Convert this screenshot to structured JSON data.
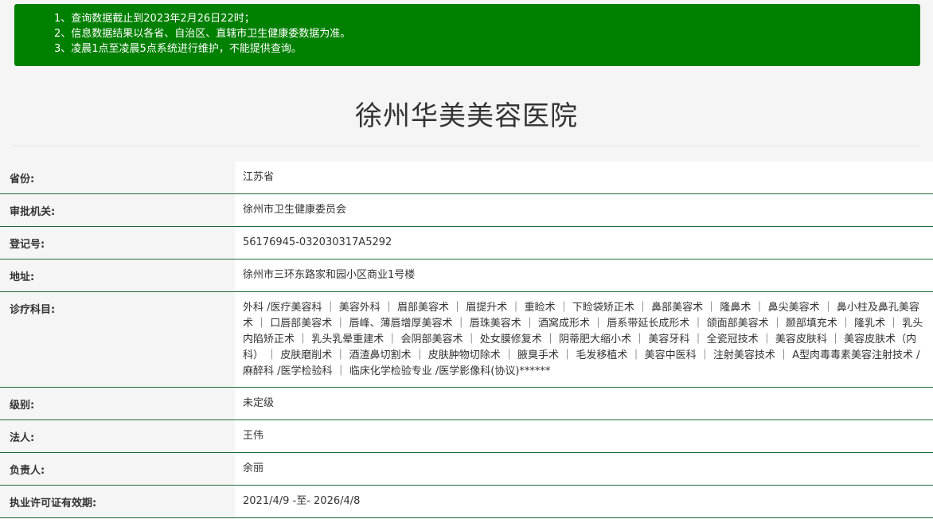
{
  "notice": {
    "lines": [
      "1、查询数据截止到2023年2月26日22时；",
      "2、信息数据结果以各省、自治区、直辖市卫生健康委数据为准。",
      "3、凌晨1点至凌晨5点系统进行维护，不能提供查询。"
    ]
  },
  "page": {
    "title": "徐州华美美容医院"
  },
  "info": {
    "province": {
      "label": "省份:",
      "value": "江苏省"
    },
    "authority": {
      "label": "审批机关:",
      "value": "徐州市卫生健康委员会"
    },
    "reg_no": {
      "label": "登记号:",
      "value": "56176945-032030317A5292"
    },
    "address": {
      "label": "地址:",
      "value": "徐州市三环东路家和园小区商业1号楼"
    },
    "departments": {
      "label": "诊疗科目:",
      "value": "外科 /医疗美容科 ｜ 美容外科 ｜ 眉部美容术 ｜ 眉提升术 ｜ 重睑术 ｜ 下睑袋矫正术 ｜ 鼻部美容术 ｜ 隆鼻术 ｜ 鼻尖美容术 ｜ 鼻小柱及鼻孔美容术 ｜ 口唇部美容术 ｜ 唇峰、薄唇增厚美容术 ｜ 唇珠美容术 ｜ 酒窝成形术 ｜ 唇系带延长成形术 ｜ 颌面部美容术 ｜ 颞部填充术 ｜ 隆乳术 ｜ 乳头内陷矫正术 ｜ 乳头乳晕重建术 ｜ 会阴部美容术 ｜ 处女膜修复术 ｜ 阴蒂肥大缩小术 ｜ 美容牙科 ｜ 全瓷冠技术 ｜ 美容皮肤科 ｜ 美容皮肤术（内科） ｜ 皮肤磨削术 ｜ 酒渣鼻切割术 ｜ 皮肤肿物切除术 ｜ 腋臭手术 ｜ 毛发移植术 ｜ 美容中医科 ｜ 注射美容技术 ｜ A型肉毒毒素美容注射技术 /麻醉科 /医学检验科 ｜ 临床化学检验专业 /医学影像科(协议)******"
    },
    "level": {
      "label": "级别:",
      "value": "未定级"
    },
    "legal_person": {
      "label": "法人:",
      "value": "王伟"
    },
    "principal": {
      "label": "负责人:",
      "value": "余丽"
    },
    "license_validity": {
      "label": "执业许可证有效期:",
      "value": "2021/4/9 -至- 2026/4/8"
    }
  },
  "colors": {
    "notice_bg": "#008000",
    "row_border": "#1e6b3a",
    "page_bg": "#f5f5f5"
  }
}
